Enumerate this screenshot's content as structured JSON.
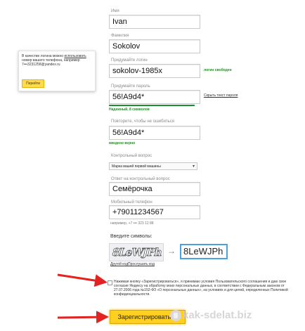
{
  "form": {
    "first_name": {
      "label": "Имя",
      "value": "Ivan"
    },
    "last_name": {
      "label": "Фамилия",
      "value": "Sokolov"
    },
    "login": {
      "label": "Придумайте логин",
      "value": "sokolov-1985x",
      "status": "логин свободен"
    },
    "password": {
      "label": "Придумайте пароль",
      "value": "56!A9d4*",
      "hide_link": "Скрыть текст пароля",
      "strength": "Надежный, 8 символов"
    },
    "password_repeat": {
      "label": "Повторите, чтобы не ошибиться",
      "value": "56!A9d4*",
      "match": "введено верно"
    },
    "question": {
      "label": "Контрольный вопрос",
      "selected": "Марка вашей первой машины"
    },
    "answer": {
      "label": "Ответ на контрольный вопрос",
      "value": "Семёрочка"
    },
    "phone": {
      "label": "Мобильный телефон",
      "value": "+79011234567",
      "example": "например, +7 ••• 323 12 88"
    },
    "captcha": {
      "label": "Введите символы:",
      "image_text": "8LeWJPh",
      "value": "8LeWJPh",
      "other_code": "Другой код",
      "listen": "Прослушать код"
    },
    "terms": "Нажимая кнопку «Зарегистрироваться», я принимаю условия Пользовательского соглашения и даю свое согласие Яндексу на обработку моих персональных данных, в соответствии с Федеральным законом от 27.07.2006 года №152-ФЗ «О персональных данных», на условиях и для целей, определенных Политикой конфиденциальности.",
    "submit_label": "Зарегистрироваться"
  },
  "hint": {
    "text_before": "В качестве логина можно",
    "text_link": "использовать",
    "text_after": "номер вашего телефона, например 7•••3231258@yandex.ru",
    "button": "Перейти"
  },
  "watermark": "kak-sdelat.biz",
  "colors": {
    "accent": "#ffcf21",
    "success": "#2a8a2a",
    "arrow": "#e32222",
    "focus": "#4aa3df"
  }
}
